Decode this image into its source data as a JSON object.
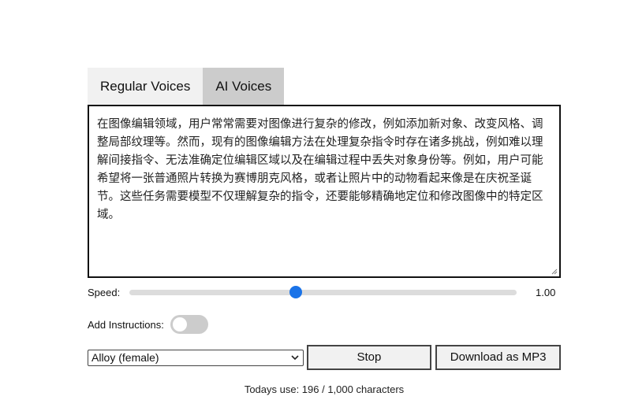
{
  "tabs": [
    {
      "label": "Regular Voices",
      "active": false
    },
    {
      "label": "AI Voices",
      "active": true
    }
  ],
  "text_input": {
    "value": "在图像编辑领域，用户常常需要对图像进行复杂的修改，例如添加新对象、改变风格、调整局部纹理等。然而，现有的图像编辑方法在处理复杂指令时存在诸多挑战，例如难以理解间接指令、无法准确定位编辑区域以及在编辑过程中丢失对象身份等。例如，用户可能希望将一张普通照片转换为赛博朋克风格，或者让照片中的动物看起来像是在庆祝圣诞节。这些任务需要模型不仅理解复杂的指令，还要能够精确地定位和修改图像中的特定区域。"
  },
  "speed": {
    "label": "Speed:",
    "value_text": "1.00",
    "fraction": 0.43
  },
  "instructions": {
    "label": "Add Instructions:",
    "enabled": false
  },
  "voice_select": {
    "selected": "Alloy (female)"
  },
  "buttons": {
    "stop": "Stop",
    "download": "Download as MP3"
  },
  "usage": {
    "text": "Todays use: 196 / 1,000 characters"
  },
  "colors": {
    "slider_thumb": "#1a73e8",
    "active_tab": "#cccccc",
    "inactive_tab": "#f1f1f1",
    "toggle_off": "#cccccc"
  },
  "icons": {
    "select_arrow": "chevron-down-icon",
    "resize_grip": "resize-grip-icon"
  }
}
